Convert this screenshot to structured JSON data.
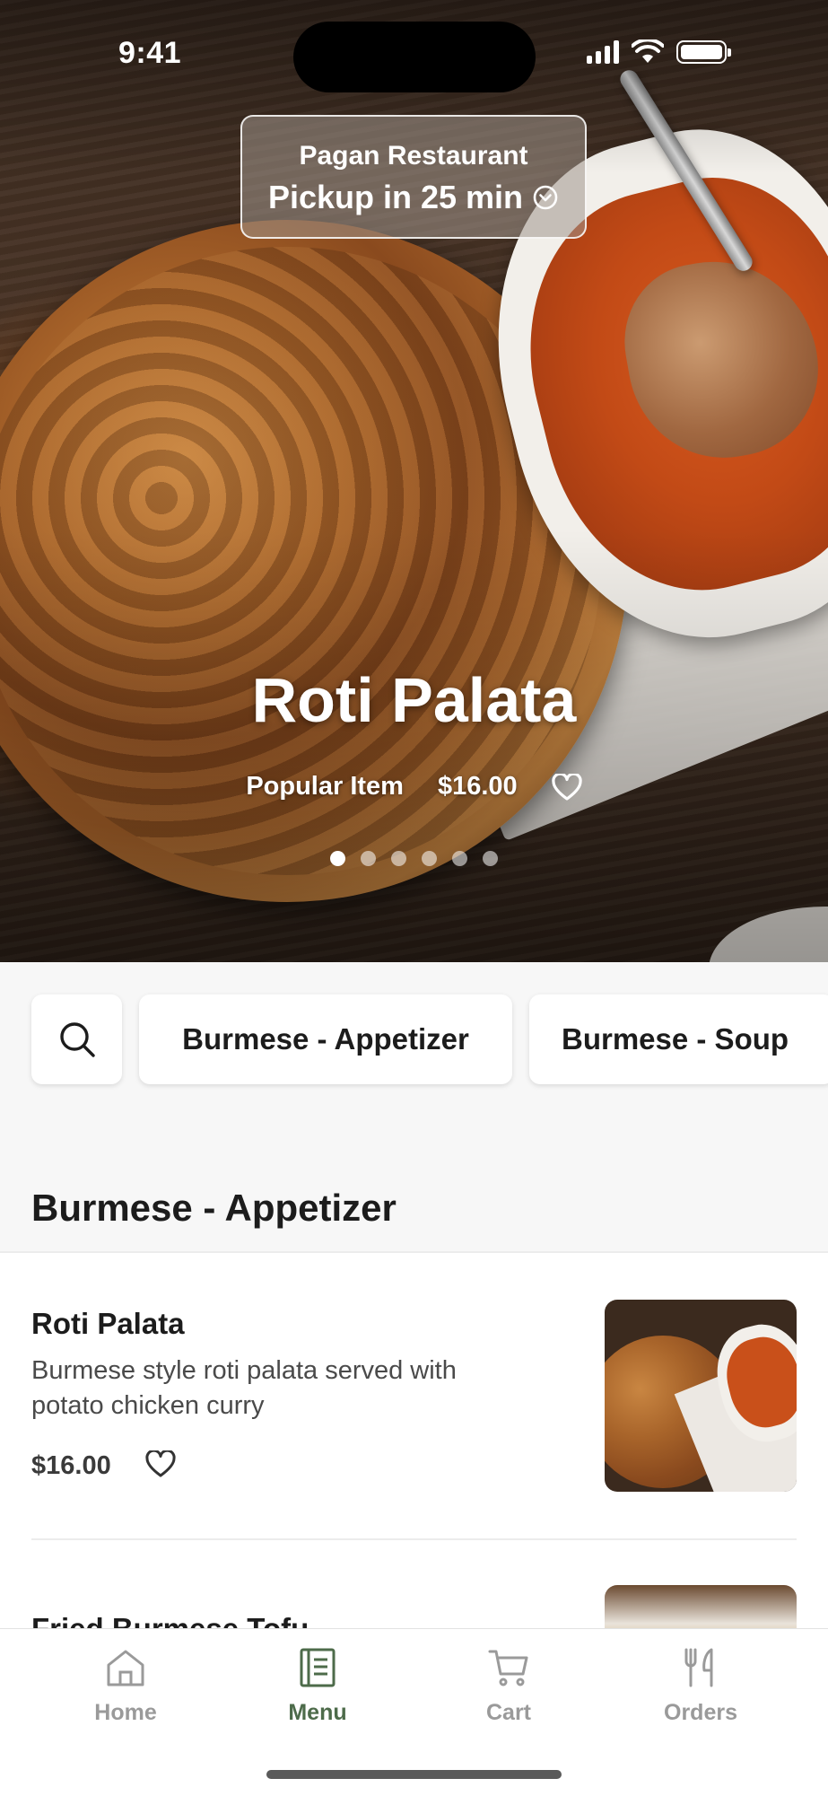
{
  "status_bar": {
    "time": "9:41"
  },
  "header": {
    "restaurant_name": "Pagan Restaurant",
    "pickup_text": "Pickup in 25 min"
  },
  "featured": {
    "title": "Roti Palata",
    "tag": "Popular Item",
    "price": "$16.00",
    "carousel_count": 6,
    "carousel_active_index": 0
  },
  "categories": [
    {
      "label": "Burmese - Appetizer"
    },
    {
      "label": "Burmese - Soup"
    }
  ],
  "section": {
    "title": "Burmese - Appetizer",
    "items": [
      {
        "name": "Roti Palata",
        "description": "Burmese style roti palata served with potato chicken curry",
        "price": "$16.00"
      },
      {
        "name": "Fried Burmese Tofu"
      }
    ]
  },
  "tab_bar": {
    "items": [
      {
        "label": "Home",
        "icon": "home-icon"
      },
      {
        "label": "Menu",
        "icon": "menu-icon"
      },
      {
        "label": "Cart",
        "icon": "cart-icon"
      },
      {
        "label": "Orders",
        "icon": "orders-icon"
      }
    ],
    "active": "Menu"
  },
  "colors": {
    "accent": "#4d6b4a",
    "inactive_tab": "#9a9a9a",
    "background": "#f7f7f7"
  }
}
